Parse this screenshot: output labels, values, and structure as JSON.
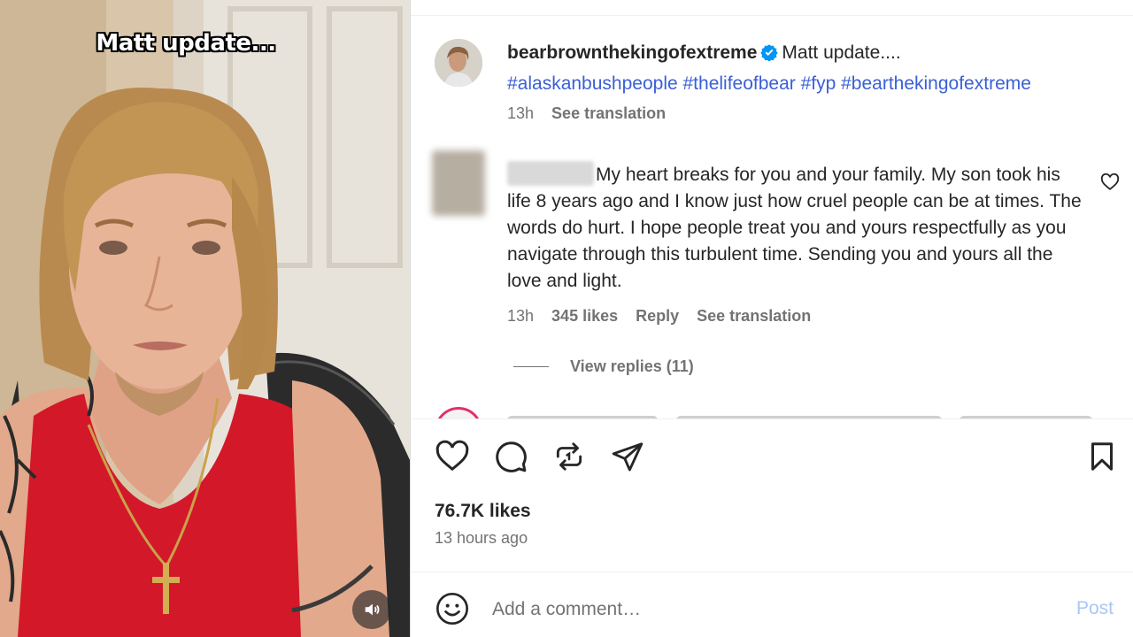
{
  "video": {
    "caption": "Matt update...",
    "mute_icon": "speaker-icon"
  },
  "post": {
    "username": "bearbrownthekingofextreme",
    "verified_icon": "verified-badge-icon",
    "caption_text": "Matt update....",
    "hashtags": "#alaskanbushpeople #thelifeofbear #fyp #bearthekingofextreme",
    "time": "13h",
    "see_translation": "See translation"
  },
  "comment": {
    "text": "My heart breaks for you and your family. My son took his life 8 years ago and I know just how cruel people can be at times. The words do hurt. I hope people treat you and yours respectfully as you navigate through this turbulent time. Sending you and yours all the love and light.",
    "time": "13h",
    "likes": "345 likes",
    "reply": "Reply",
    "see_translation": "See translation",
    "view_replies": "View replies (11)"
  },
  "actions": {
    "like_icon": "heart-icon",
    "comment_icon": "comment-bubble-icon",
    "repost_icon": "repost-icon",
    "share_icon": "paper-plane-icon",
    "save_icon": "bookmark-icon"
  },
  "stats": {
    "likes": "76.7K likes",
    "time_ago": "13 hours ago"
  },
  "comment_box": {
    "placeholder": "Add a comment…",
    "post_label": "Post",
    "emoji_icon": "smiley-face-icon"
  },
  "colors": {
    "hashtag": "#3a5fd6",
    "verified": "#0095f6",
    "post_disabled": "#a7c8f5",
    "tank_top": "#d3182a"
  }
}
